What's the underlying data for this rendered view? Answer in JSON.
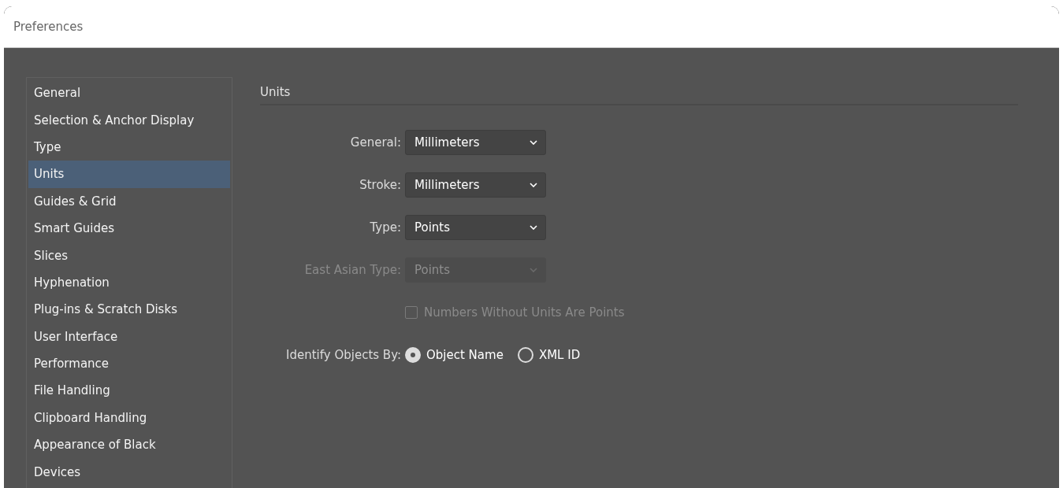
{
  "window": {
    "title": "Preferences"
  },
  "sidebar": {
    "items": [
      {
        "label": "General",
        "selected": false
      },
      {
        "label": "Selection & Anchor Display",
        "selected": false
      },
      {
        "label": "Type",
        "selected": false
      },
      {
        "label": "Units",
        "selected": true
      },
      {
        "label": "Guides & Grid",
        "selected": false
      },
      {
        "label": "Smart Guides",
        "selected": false
      },
      {
        "label": "Slices",
        "selected": false
      },
      {
        "label": "Hyphenation",
        "selected": false
      },
      {
        "label": "Plug-ins & Scratch Disks",
        "selected": false
      },
      {
        "label": "User Interface",
        "selected": false
      },
      {
        "label": "Performance",
        "selected": false
      },
      {
        "label": "File Handling",
        "selected": false
      },
      {
        "label": "Clipboard Handling",
        "selected": false
      },
      {
        "label": "Appearance of Black",
        "selected": false
      },
      {
        "label": "Devices",
        "selected": false
      }
    ]
  },
  "section": {
    "title": "Units"
  },
  "fields": [
    {
      "label": "General:",
      "value": "Millimeters",
      "disabled": false
    },
    {
      "label": "Stroke:",
      "value": "Millimeters",
      "disabled": false
    },
    {
      "label": "Type:",
      "value": "Points",
      "disabled": false
    },
    {
      "label": "East Asian Type:",
      "value": "Points",
      "disabled": true
    }
  ],
  "checkbox": {
    "label": "Numbers Without Units Are Points",
    "checked": false,
    "disabled": true
  },
  "identify": {
    "label": "Identify Objects By:",
    "options": [
      {
        "label": "Object Name",
        "selected": true
      },
      {
        "label": "XML ID",
        "selected": false
      }
    ]
  }
}
